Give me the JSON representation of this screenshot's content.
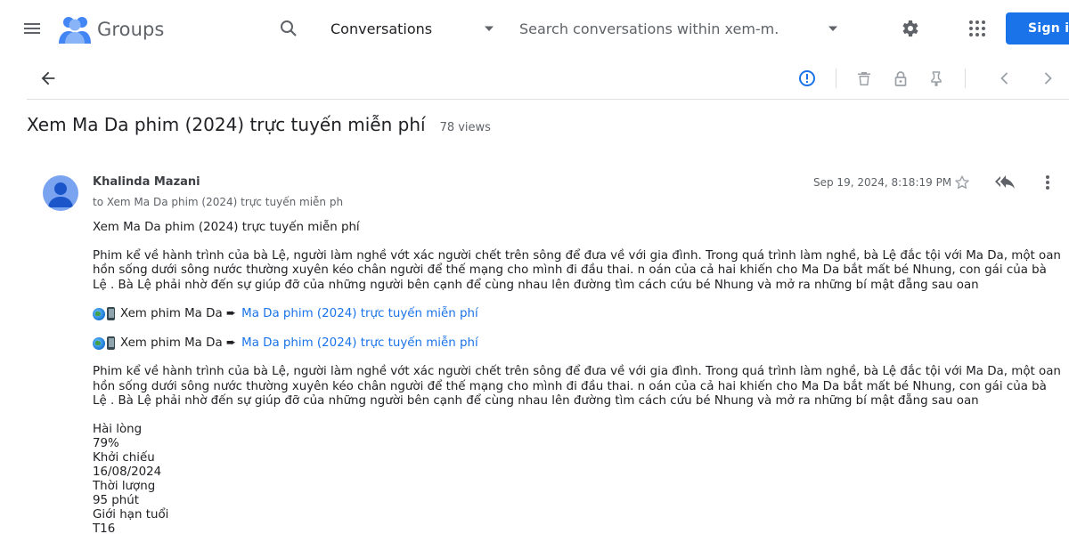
{
  "header": {
    "logo_text": "Groups",
    "scope_label": "Conversations",
    "search_placeholder": "Search conversations within xem-m...",
    "signin_label": "Sign in"
  },
  "thread": {
    "title": "Xem Ma Da phim (2024) trực tuyến miễn phí",
    "views": "78 views"
  },
  "message": {
    "author": "Khalinda Mazani",
    "recipient": "to Xem Ma Da phim (2024) trực tuyến miễn ph",
    "date": "Sep 19, 2024, 8:18:19 PM",
    "subject_line": "Xem Ma Da phim (2024) trực tuyến miễn phí",
    "paragraph_1": "Phim kể về hành trình của bà Lệ, người làm nghề vớt xác người chết trên sông để đưa về với gia đình. Trong quá trình làm nghề, bà Lệ đắc tội với Ma Da, một oan hồn sống dưới sông nước thường xuyên kéo chân người để thế mạng cho mình đi đầu thai. n oán của cả hai khiến cho Ma Da bắt mất bé Nhung, con gái của bà Lệ . Bà Lệ phải nhờ đến sự giúp đỡ của những người bên cạnh để cùng nhau lên đường tìm cách cứu bé Nhung và mở ra những bí mật đẵng sau oan",
    "link_prefix": "Xem phim Ma Da ➨",
    "link_text": "Ma Da phim (2024) trực tuyến miễn phí",
    "paragraph_2": "Phim kể về hành trình của bà Lệ, người làm nghề vớt xác người chết trên sông để đưa về với gia đình. Trong quá trình làm nghề, bà Lệ đắc tội với Ma Da, một oan hồn sống dưới sông nước thường xuyên kéo chân người để thế mạng cho mình đi đầu thai. n oán của cả hai khiến cho Ma Da bắt mất bé Nhung, con gái của bà Lệ . Bà Lệ phải nhờ đến sự giúp đỡ của những người bên cạnh để cùng nhau lên đường tìm cách cứu bé Nhung và mở ra những bí mật đẵng sau oan",
    "stats": [
      "Hài lòng",
      "79%",
      "Khởi chiếu",
      "16/08/2024",
      "Thời lượng",
      "95 phút",
      "Giới hạn tuổi",
      "T16"
    ]
  },
  "icons": {
    "menu": "menu-icon",
    "search": "search-icon",
    "settings": "gear-icon",
    "apps": "apps-grid-icon",
    "back": "arrow-back-icon",
    "report": "report-icon",
    "delete": "trash-icon",
    "lock": "lock-icon",
    "pin": "pin-icon",
    "prev": "chevron-left-icon",
    "next": "chevron-right-icon",
    "star": "star-icon",
    "reply_all": "reply-all-icon",
    "more": "more-vert-icon"
  },
  "colors": {
    "accent": "#1a73e8",
    "avatar": "#7aa4f0"
  }
}
